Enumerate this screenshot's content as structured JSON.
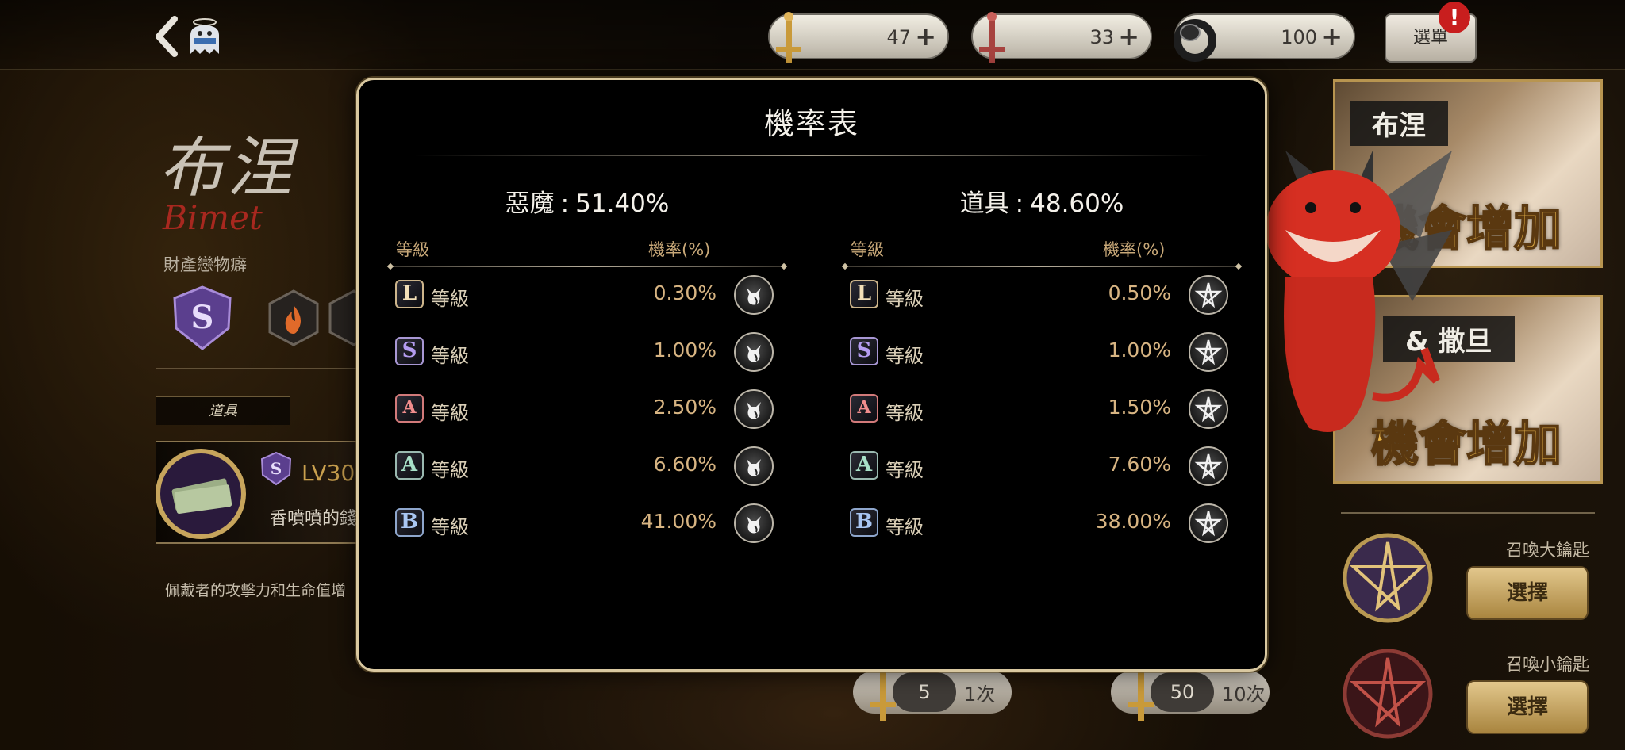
{
  "header": {
    "currencies": [
      {
        "value": "47",
        "plus": "+"
      },
      {
        "value": "33",
        "plus": "+"
      },
      {
        "value": "100",
        "plus": "+"
      }
    ],
    "menu_label": "選單",
    "alert": "!"
  },
  "character": {
    "name": "布涅",
    "name_en": "Bimet",
    "trait": "財產戀物癖",
    "item_tab": "道具",
    "item_level": "LV30",
    "item_name": "香噴噴的錢",
    "item_desc": "佩戴者的攻擊力和生命值增"
  },
  "right_panel": {
    "banner1_tag": "布涅",
    "banner1_boost": "機會增加",
    "banner2_tag": "& 撒旦",
    "banner2_boost": "機會增加",
    "summon_big_label": "召喚大鑰匙",
    "summon_small_label": "召喚小鑰匙",
    "select_label": "選擇"
  },
  "bottom_bar": {
    "left_count": "5",
    "left_times": "1次",
    "right_count": "50",
    "right_times": "10次"
  },
  "modal": {
    "title": "機率表",
    "demon": {
      "label": "惡魔",
      "percent": "51.40%",
      "grade_header": "等級",
      "rate_header": "機率(%)",
      "rows": [
        {
          "grade": "L",
          "word": "等級",
          "rate": "0.30%"
        },
        {
          "grade": "S",
          "word": "等級",
          "rate": "1.00%"
        },
        {
          "grade": "A",
          "word": "等級",
          "rate": "2.50%"
        },
        {
          "grade": "A",
          "word": "等級",
          "rate": "6.60%"
        },
        {
          "grade": "B",
          "word": "等級",
          "rate": "41.00%"
        }
      ]
    },
    "item": {
      "label": "道具",
      "percent": "48.60%",
      "grade_header": "等級",
      "rate_header": "機率(%)",
      "rows": [
        {
          "grade": "L",
          "word": "等級",
          "rate": "0.50%"
        },
        {
          "grade": "S",
          "word": "等級",
          "rate": "1.00%"
        },
        {
          "grade": "A",
          "word": "等級",
          "rate": "1.50%"
        },
        {
          "grade": "A",
          "word": "等級",
          "rate": "7.60%"
        },
        {
          "grade": "B",
          "word": "等級",
          "rate": "38.00%"
        }
      ]
    }
  },
  "icons": {
    "demon_rate_icon": "cat-head-icon",
    "item_rate_icon": "pentagram-icon"
  },
  "colors": {
    "modal_border": "#d9c8a0",
    "rate_text": "#d7b482",
    "header_text": "#c8a878"
  }
}
